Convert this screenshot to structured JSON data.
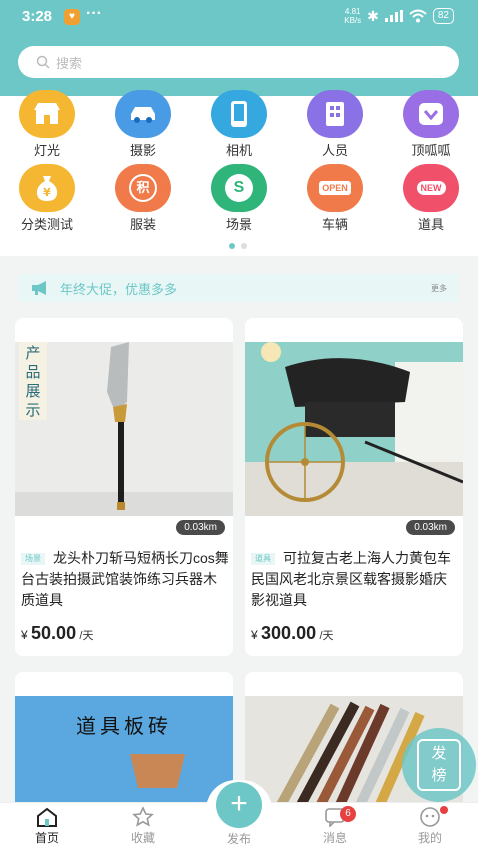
{
  "status": {
    "time": "3:28",
    "speed_value": "4.81",
    "speed_unit": "KB/s",
    "battery": "82"
  },
  "search": {
    "placeholder": "搜索"
  },
  "categories": [
    {
      "label": "灯光",
      "icon": "shop-icon",
      "color": "#f5b731"
    },
    {
      "label": "摄影",
      "icon": "car-icon",
      "color": "#4a9be6"
    },
    {
      "label": "相机",
      "icon": "phone-icon",
      "color": "#35a8e0"
    },
    {
      "label": "人员",
      "icon": "building-icon",
      "color": "#8a72e6"
    },
    {
      "label": "顶呱呱",
      "icon": "heart-icon",
      "color": "#9a6fe6"
    },
    {
      "label": "分类测试",
      "icon": "money-bag-icon",
      "color": "#f5b731"
    },
    {
      "label": "服装",
      "icon": "points-icon",
      "color": "#f07a4a",
      "text": "积"
    },
    {
      "label": "场景",
      "icon": "dollar-icon",
      "color": "#2fb57a",
      "text": "S"
    },
    {
      "label": "车辆",
      "icon": "open-sign-icon",
      "color": "#f07a4a",
      "text": "OPEN"
    },
    {
      "label": "道具",
      "icon": "new-icon",
      "color": "#f0506a",
      "text": "NEW"
    }
  ],
  "promo": {
    "text": "年终大促，优惠多多",
    "more": "更多"
  },
  "products": [
    {
      "badge": "产品展示",
      "distance": "0.03km",
      "tag": "场景",
      "title": "龙头朴刀斩马短柄长刀cos舞台古装拍摄武馆装饰练习兵器木质道具",
      "currency": "¥",
      "price": "50.00",
      "unit": "/天"
    },
    {
      "distance": "0.03km",
      "tag": "道具",
      "title": "可拉复古老上海人力黄包车民国风老北京景区载客摄影婚庆影视道具",
      "currency": "¥",
      "price": "300.00",
      "unit": "/天"
    },
    {
      "poster_title": "道具板砖"
    },
    {}
  ],
  "float_button": {
    "line1": "发",
    "line2": "榜"
  },
  "tabs": {
    "home": "首页",
    "favorites": "收藏",
    "publish": "发布",
    "messages": "消息",
    "messages_badge": "6",
    "mine": "我的"
  }
}
